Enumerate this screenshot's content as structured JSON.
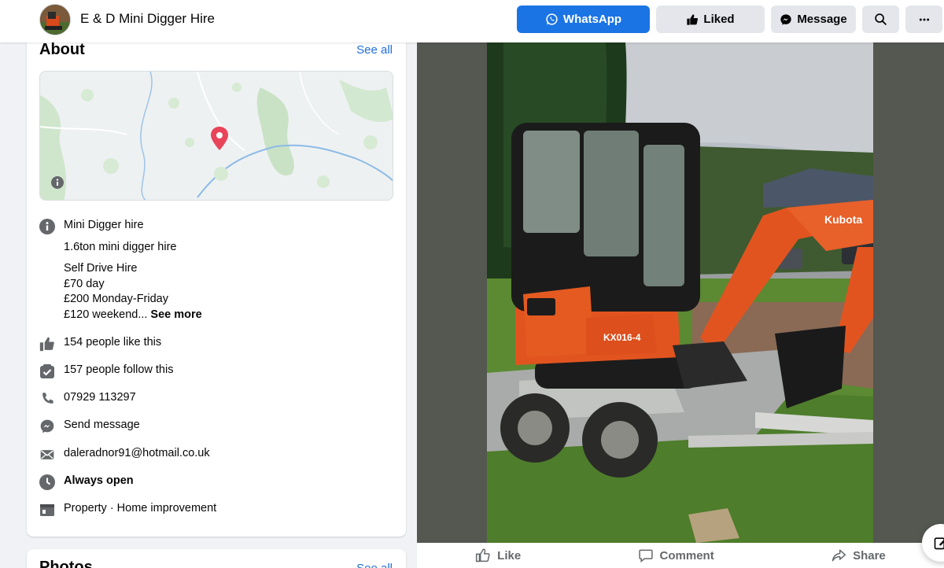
{
  "header": {
    "page_name": "E & D Mini Digger Hire",
    "buttons": {
      "whatsapp": "WhatsApp",
      "liked": "Liked",
      "message": "Message"
    }
  },
  "about": {
    "title": "About",
    "see_all": "See all",
    "category_title": "Mini Digger hire",
    "description_lines": [
      "1.6ton mini digger hire",
      "Self Drive Hire",
      "£70 day",
      "£200 Monday-Friday",
      "£120 weekend..."
    ],
    "see_more": "See more",
    "likes": "154 people like this",
    "follows": "157 people follow this",
    "phone": "07929 113297",
    "send_message": "Send message",
    "email": "daleradnor91@hotmail.co.uk",
    "hours": "Always open",
    "categories": "Property · Home improvement"
  },
  "photos": {
    "title": "Photos",
    "see_all": "See all"
  },
  "post": {
    "photo_text": "KX016-4",
    "brand_text": "Kubota",
    "actions": {
      "like": "Like",
      "comment": "Comment",
      "share": "Share"
    }
  },
  "colors": {
    "brand_blue": "#1b74e4",
    "link_blue": "#216fdb",
    "open_green": "#31a24c",
    "kubota_orange": "#e2541f"
  }
}
